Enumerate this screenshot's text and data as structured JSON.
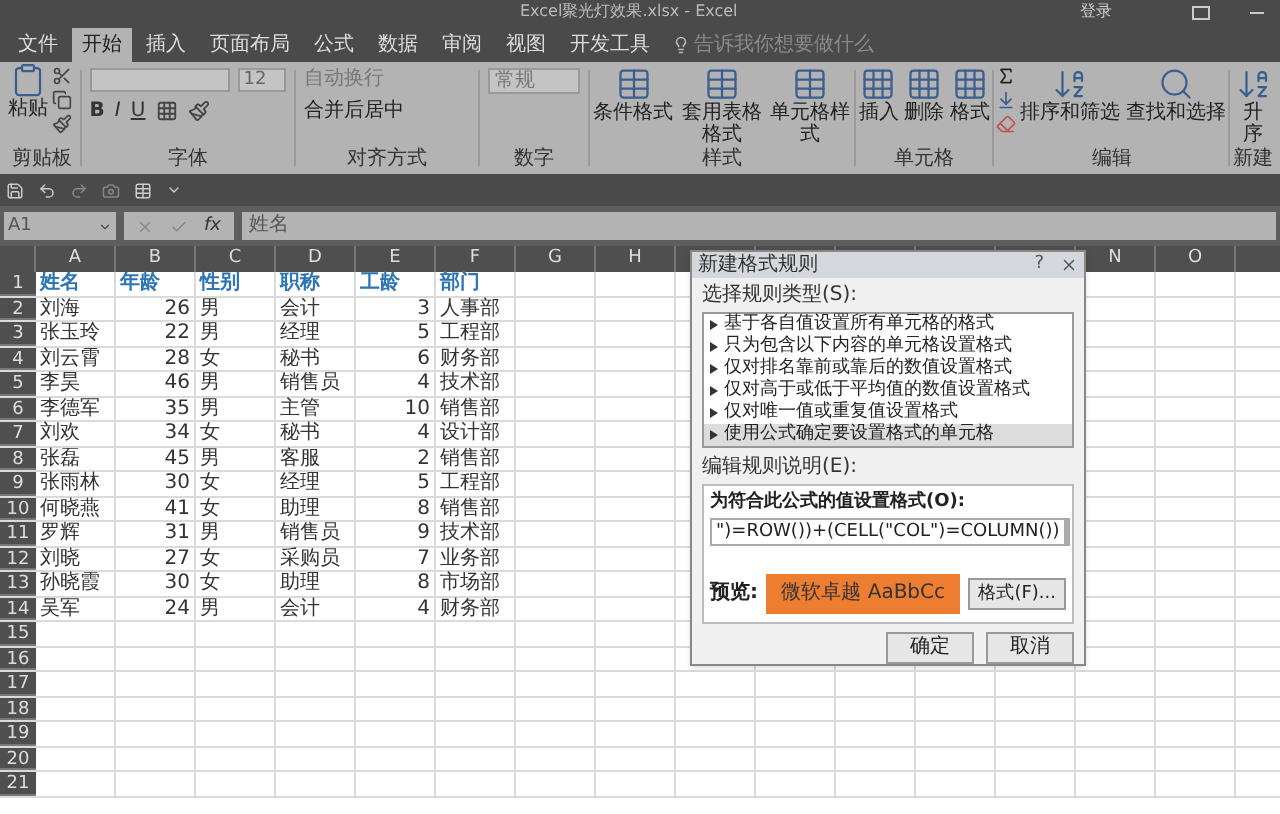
{
  "window": {
    "title": "Excel聚光灯效果.xlsx - Excel",
    "sign_in": "登录"
  },
  "tabs": [
    {
      "label": "文件",
      "selected": false
    },
    {
      "label": "开始",
      "selected": true
    },
    {
      "label": "插入",
      "selected": false
    },
    {
      "label": "页面布局",
      "selected": false
    },
    {
      "label": "公式",
      "selected": false
    },
    {
      "label": "数据",
      "selected": false
    },
    {
      "label": "审阅",
      "selected": false
    },
    {
      "label": "视图",
      "selected": false
    },
    {
      "label": "开发工具",
      "selected": false
    }
  ],
  "tell_me": {
    "placeholder": "告诉我你想要做什么"
  },
  "ribbon": {
    "clipboard": {
      "label": "剪贴板",
      "paste": "粘贴"
    },
    "font": {
      "label": "字体",
      "size": "12",
      "styles": [
        "B",
        "I",
        "U"
      ]
    },
    "alignment": {
      "label": "对齐方式",
      "wrap": "自动换行",
      "merge": "合并后居中"
    },
    "number": {
      "label": "数字",
      "format": "常规"
    },
    "styles": {
      "label": "样式",
      "buttons": [
        "条件格式",
        "套用表格格式",
        "单元格样式"
      ]
    },
    "cells": {
      "label": "单元格",
      "buttons": [
        "插入",
        "删除",
        "格式"
      ]
    },
    "editing": {
      "label": "编辑",
      "buttons": [
        "排序和筛选",
        "查找和选择"
      ]
    },
    "new_group": {
      "label": "新建",
      "button": "升序"
    }
  },
  "formula_bar": {
    "name_box": "A1",
    "function_label": "fx",
    "content": "姓名"
  },
  "columns_left": [
    "A",
    "B",
    "C",
    "D",
    "E",
    "F",
    "G",
    "H"
  ],
  "columns_right": [
    "N",
    "O"
  ],
  "rows": [
    {
      "number": "1",
      "kind": "header",
      "cells": [
        "姓名",
        "年龄",
        "性别",
        "职称",
        "工龄",
        "部门"
      ]
    },
    {
      "number": "2",
      "kind": "data",
      "cells": [
        "刘海",
        "26",
        "男",
        "会计",
        "3",
        "人事部"
      ]
    },
    {
      "number": "3",
      "kind": "data",
      "cells": [
        "张玉玲",
        "22",
        "男",
        "经理",
        "5",
        "工程部"
      ]
    },
    {
      "number": "4",
      "kind": "data",
      "cells": [
        "刘云霄",
        "28",
        "女",
        "秘书",
        "6",
        "财务部"
      ]
    },
    {
      "number": "5",
      "kind": "data",
      "cells": [
        "李昊",
        "46",
        "男",
        "销售员",
        "4",
        "技术部"
      ]
    },
    {
      "number": "6",
      "kind": "data",
      "cells": [
        "李德军",
        "35",
        "男",
        "主管",
        "10",
        "销售部"
      ]
    },
    {
      "number": "7",
      "kind": "data",
      "cells": [
        "刘欢",
        "34",
        "女",
        "秘书",
        "4",
        "设计部"
      ]
    },
    {
      "number": "8",
      "kind": "data",
      "cells": [
        "张磊",
        "45",
        "男",
        "客服",
        "2",
        "销售部"
      ]
    },
    {
      "number": "9",
      "kind": "data",
      "cells": [
        "张雨林",
        "30",
        "女",
        "经理",
        "5",
        "工程部"
      ]
    },
    {
      "number": "10",
      "kind": "data",
      "cells": [
        "何晓燕",
        "41",
        "女",
        "助理",
        "8",
        "销售部"
      ]
    },
    {
      "number": "11",
      "kind": "data",
      "cells": [
        "罗辉",
        "31",
        "男",
        "销售员",
        "9",
        "技术部"
      ]
    },
    {
      "number": "12",
      "kind": "data",
      "cells": [
        "刘晓",
        "27",
        "女",
        "采购员",
        "7",
        "业务部"
      ]
    },
    {
      "number": "13",
      "kind": "data",
      "cells": [
        "孙晓霞",
        "30",
        "女",
        "助理",
        "8",
        "市场部"
      ]
    },
    {
      "number": "14",
      "kind": "data",
      "cells": [
        "吴军",
        "24",
        "男",
        "会计",
        "4",
        "财务部"
      ]
    },
    {
      "number": "15",
      "kind": "empty"
    },
    {
      "number": "16",
      "kind": "empty"
    },
    {
      "number": "17",
      "kind": "empty"
    },
    {
      "number": "18",
      "kind": "empty"
    },
    {
      "number": "19",
      "kind": "empty"
    },
    {
      "number": "20",
      "kind": "empty"
    },
    {
      "number": "21",
      "kind": "empty"
    }
  ],
  "dialog": {
    "title": "新建格式规则",
    "help": "?",
    "rule_type_label": "选择规则类型(S):",
    "rule_types": [
      {
        "label": "基于各自值设置所有单元格的格式",
        "selected": false
      },
      {
        "label": "只为包含以下内容的单元格设置格式",
        "selected": false
      },
      {
        "label": "仅对排名靠前或靠后的数值设置格式",
        "selected": false
      },
      {
        "label": "仅对高于或低于平均值的数值设置格式",
        "selected": false
      },
      {
        "label": "仅对唯一值或重复值设置格式",
        "selected": false
      },
      {
        "label": "使用公式确定要设置格式的单元格",
        "selected": true
      }
    ],
    "edit_label": "编辑规则说明(E):",
    "formula_label": "为符合此公式的值设置格式(O):",
    "formula": "\")=ROW())+(CELL(\"COL\")=COLUMN())",
    "preview_label": "预览:",
    "preview_text": "微软卓越  AaBbCc",
    "format_button": "格式(F)...",
    "ok": "确定",
    "cancel": "取消"
  }
}
